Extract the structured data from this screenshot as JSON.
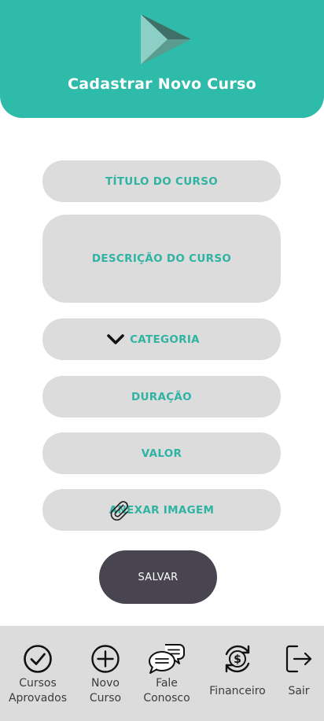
{
  "header": {
    "title": "Cadastrar Novo Curso",
    "logo_icon": "play-triangle-logo-icon",
    "background": "#2fbba9"
  },
  "form": {
    "title_field": "TÍTULO DO CURSO",
    "description_field": "DESCRIÇÃO DO CURSO",
    "category_field": "CATEGORIA",
    "category_icon": "chevron-down-icon",
    "duration_field": "DURAÇÃO",
    "value_field": "VALOR",
    "attach_field": "ANEXAR IMAGEM",
    "attach_icon": "paperclip-icon",
    "field_background": "#dcdcdc",
    "field_text_color": "#2fb3a2"
  },
  "save_button": {
    "label": "SALVAR",
    "background": "#484551"
  },
  "bottom_nav": {
    "items": [
      {
        "line1": "Cursos",
        "line2": "Aprovados",
        "icon": "check-circle-icon"
      },
      {
        "line1": "Novo",
        "line2": "Curso",
        "icon": "plus-circle-icon"
      },
      {
        "line1": "Fale",
        "line2": "Conosco",
        "icon": "chat-bubbles-icon"
      },
      {
        "line1": "Financeiro",
        "line2": "",
        "icon": "dollar-refresh-icon"
      },
      {
        "line1": "Sair",
        "line2": "",
        "icon": "logout-icon"
      }
    ]
  }
}
